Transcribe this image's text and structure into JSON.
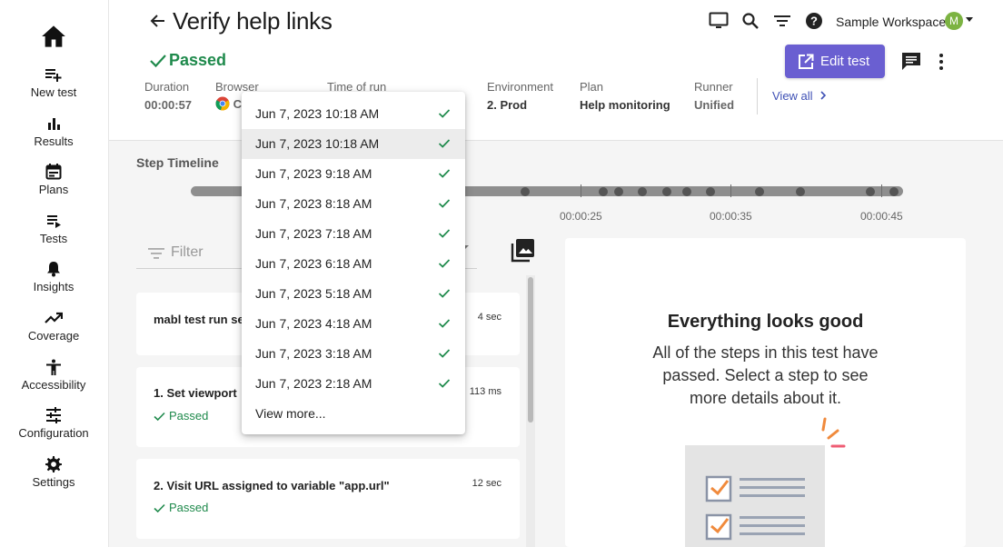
{
  "header": {
    "title": "Verify help links",
    "workspace": "Sample Workspace",
    "avatar_letter": "M",
    "status": "Passed",
    "edit_button": "Edit test",
    "view_all": "View all",
    "meta": [
      {
        "label": "Duration",
        "value": "00:00:57"
      },
      {
        "label": "Browser",
        "value": "C"
      },
      {
        "label": "Time of run",
        "value": ""
      },
      {
        "label": "Environment",
        "value": "2. Prod"
      },
      {
        "label": "Plan",
        "value": "Help monitoring"
      },
      {
        "label": "Runner",
        "value": "Unified"
      }
    ]
  },
  "sidebar": {
    "items": [
      {
        "label": "New test",
        "icon": "playlist-add-icon"
      },
      {
        "label": "Results",
        "icon": "bar-chart-icon"
      },
      {
        "label": "Plans",
        "icon": "calendar-icon"
      },
      {
        "label": "Tests",
        "icon": "playlist-play-icon"
      },
      {
        "label": "Insights",
        "icon": "bell-icon"
      },
      {
        "label": "Coverage",
        "icon": "trending-up-icon"
      },
      {
        "label": "Accessibility",
        "icon": "accessibility-icon"
      },
      {
        "label": "Configuration",
        "icon": "tune-icon"
      },
      {
        "label": "Settings",
        "icon": "gear-icon"
      }
    ]
  },
  "timeline": {
    "title": "Step Timeline",
    "tick_labels": [
      "00:00:25",
      "00:00:35",
      "00:00:45"
    ]
  },
  "filter": {
    "placeholder": "Filter"
  },
  "steps": [
    {
      "title": "mabl test run se",
      "duration": "4 sec",
      "status": ""
    },
    {
      "title": "1. Set viewport",
      "duration": "113 ms",
      "status": "Passed"
    },
    {
      "title": "2. Visit URL assigned to variable \"app.url\"",
      "duration": "12 sec",
      "status": "Passed"
    }
  ],
  "right_panel": {
    "title": "Everything looks good",
    "body": "All of the steps in this test have passed. Select a step to see more details about it."
  },
  "run_dropdown": {
    "items": [
      "Jun 7, 2023 10:18 AM",
      "Jun 7, 2023 10:18 AM",
      "Jun 7, 2023 9:18 AM",
      "Jun 7, 2023 8:18 AM",
      "Jun 7, 2023 7:18 AM",
      "Jun 7, 2023 6:18 AM",
      "Jun 7, 2023 5:18 AM",
      "Jun 7, 2023 4:18 AM",
      "Jun 7, 2023 3:18 AM",
      "Jun 7, 2023 2:18 AM"
    ],
    "selected_index": 1,
    "view_more": "View more..."
  },
  "colors": {
    "accent": "#6a5fd1",
    "passed": "#1f8a4c",
    "link": "#3f51b5"
  }
}
